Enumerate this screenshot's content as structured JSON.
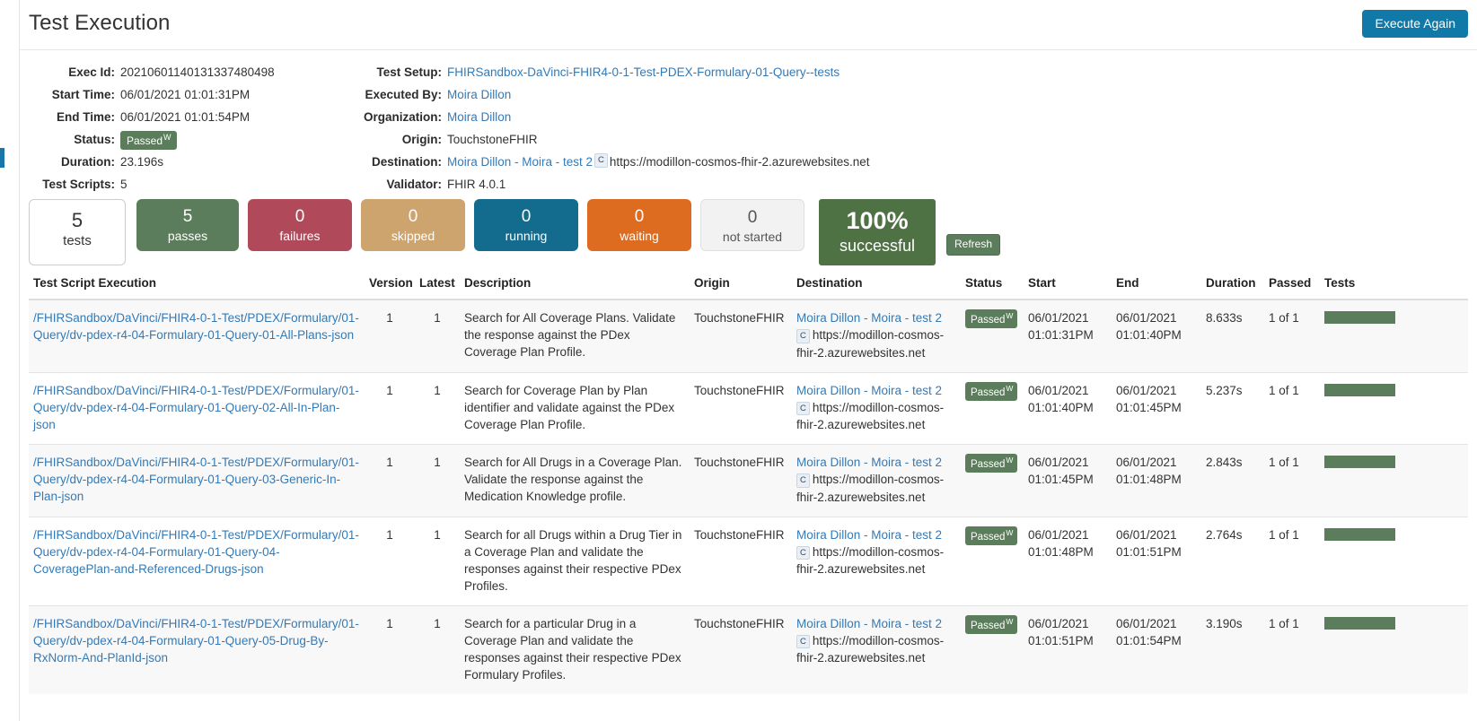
{
  "header": {
    "title": "Test Execution",
    "execute_again_label": "Execute Again"
  },
  "meta": {
    "left": [
      {
        "label": "Exec Id:",
        "value": "20210601140131337480498"
      },
      {
        "label": "Start Time:",
        "value": "06/01/2021 01:01:31PM"
      },
      {
        "label": "End Time:",
        "value": "06/01/2021 01:01:54PM"
      },
      {
        "label": "Status:",
        "value": "Passed",
        "badge_sup": "W"
      },
      {
        "label": "Duration:",
        "value": "23.196s"
      },
      {
        "label": "Test Scripts:",
        "value": "5"
      }
    ],
    "right": [
      {
        "label": "Test Setup:",
        "value": "FHIRSandbox-DaVinci-FHIR4-0-1-Test-PDEX-Formulary-01-Query--tests"
      },
      {
        "label": "Executed By:",
        "value": "Moira Dillon"
      },
      {
        "label": "Organization:",
        "value": "Moira Dillon"
      },
      {
        "label": "Origin:",
        "value": "TouchstoneFHIR"
      },
      {
        "label": "Destination:",
        "value": "Moira Dillon - Moira - test 2",
        "badge": "C",
        "url": "https://modillon-cosmos-fhir-2.azurewebsites.net"
      },
      {
        "label": "Validator:",
        "value": "FHIR 4.0.1"
      }
    ],
    "exec_id_full": "20210601140131337480498"
  },
  "stats": {
    "tests": {
      "num": "5",
      "label": "tests"
    },
    "passes": {
      "num": "5",
      "label": "passes",
      "color": "#5b7d5b"
    },
    "failures": {
      "num": "0",
      "label": "failures",
      "color": "#b04a5a"
    },
    "skipped": {
      "num": "0",
      "label": "skipped",
      "color": "#cda36e"
    },
    "running": {
      "num": "0",
      "label": "running",
      "color": "#136c8e"
    },
    "waiting": {
      "num": "0",
      "label": "waiting",
      "color": "#dd6b20"
    },
    "not_started": {
      "num": "0",
      "label": "not started",
      "color": "#f2f2f2"
    },
    "successful": {
      "num": "100%",
      "label": "successful",
      "color": "#4f7245"
    },
    "refresh_label": "Refresh"
  },
  "table": {
    "columns": [
      "Test Script Execution",
      "Version",
      "Latest",
      "Description",
      "Origin",
      "Destination",
      "Status",
      "Start",
      "End",
      "Duration",
      "Passed",
      "Tests"
    ],
    "rows": [
      {
        "script": "/FHIRSandbox/DaVinci/FHIR4-0-1-Test/PDEX/Formulary/01-Query/dv-pdex-r4-04-Formulary-01-Query-01-All-Plans-json",
        "version": "1",
        "latest": "1",
        "description": "Search for All Coverage Plans. Validate the response against the PDex Coverage Plan Profile.",
        "origin": "TouchstoneFHIR",
        "destination_name": "Moira Dillon - Moira - test 2",
        "destination_badge": "C",
        "destination_url": "https://modillon-cosmos-fhir-2.azurewebsites.net",
        "status": "Passed",
        "status_sup": "W",
        "start_date": "06/01/2021",
        "start_time": "01:01:31PM",
        "end_date": "06/01/2021",
        "end_time": "01:01:40PM",
        "duration": "8.633s",
        "passed": "1 of 1",
        "tests_pct": 100
      },
      {
        "script": "/FHIRSandbox/DaVinci/FHIR4-0-1-Test/PDEX/Formulary/01-Query/dv-pdex-r4-04-Formulary-01-Query-02-All-In-Plan-json",
        "version": "1",
        "latest": "1",
        "description": "Search for Coverage Plan by Plan identifier and validate against the PDex Coverage Plan Profile.",
        "origin": "TouchstoneFHIR",
        "destination_name": "Moira Dillon - Moira - test 2",
        "destination_badge": "C",
        "destination_url": "https://modillon-cosmos-fhir-2.azurewebsites.net",
        "status": "Passed",
        "status_sup": "W",
        "start_date": "06/01/2021",
        "start_time": "01:01:40PM",
        "end_date": "06/01/2021",
        "end_time": "01:01:45PM",
        "duration": "5.237s",
        "passed": "1 of 1",
        "tests_pct": 100
      },
      {
        "script": "/FHIRSandbox/DaVinci/FHIR4-0-1-Test/PDEX/Formulary/01-Query/dv-pdex-r4-04-Formulary-01-Query-03-Generic-In-Plan-json",
        "version": "1",
        "latest": "1",
        "description": "Search for All Drugs in a Coverage Plan. Validate the response against the Medication Knowledge profile.",
        "origin": "TouchstoneFHIR",
        "destination_name": "Moira Dillon - Moira - test 2",
        "destination_badge": "C",
        "destination_url": "https://modillon-cosmos-fhir-2.azurewebsites.net",
        "status": "Passed",
        "status_sup": "W",
        "start_date": "06/01/2021",
        "start_time": "01:01:45PM",
        "end_date": "06/01/2021",
        "end_time": "01:01:48PM",
        "duration": "2.843s",
        "passed": "1 of 1",
        "tests_pct": 100
      },
      {
        "script": "/FHIRSandbox/DaVinci/FHIR4-0-1-Test/PDEX/Formulary/01-Query/dv-pdex-r4-04-Formulary-01-Query-04-CoveragePlan-and-Referenced-Drugs-json",
        "version": "1",
        "latest": "1",
        "description": "Search for all Drugs within a Drug Tier in a Coverage Plan and validate the responses against their respective PDex Profiles.",
        "origin": "TouchstoneFHIR",
        "destination_name": "Moira Dillon - Moira - test 2",
        "destination_badge": "C",
        "destination_url": "https://modillon-cosmos-fhir-2.azurewebsites.net",
        "status": "Passed",
        "status_sup": "W",
        "start_date": "06/01/2021",
        "start_time": "01:01:48PM",
        "end_date": "06/01/2021",
        "end_time": "01:01:51PM",
        "duration": "2.764s",
        "passed": "1 of 1",
        "tests_pct": 100
      },
      {
        "script": "/FHIRSandbox/DaVinci/FHIR4-0-1-Test/PDEX/Formulary/01-Query/dv-pdex-r4-04-Formulary-01-Query-05-Drug-By-RxNorm-And-PlanId-json",
        "version": "1",
        "latest": "1",
        "description": "Search for a particular Drug in a Coverage Plan and validate the responses against their respective PDex Formulary Profiles.",
        "origin": "TouchstoneFHIR",
        "destination_name": "Moira Dillon - Moira - test 2",
        "destination_badge": "C",
        "destination_url": "https://modillon-cosmos-fhir-2.azurewebsites.net",
        "status": "Passed",
        "status_sup": "W",
        "start_date": "06/01/2021",
        "start_time": "01:01:51PM",
        "end_date": "06/01/2021",
        "end_time": "01:01:54PM",
        "duration": "3.190s",
        "passed": "1 of 1",
        "tests_pct": 100
      }
    ]
  },
  "colors": {
    "link": "#337ab7",
    "pass_green": "#5b7d5b",
    "fail_red": "#b04a5a",
    "skip_tan": "#cda36e",
    "running_blue": "#136c8e",
    "waiting_orange": "#dd6b20",
    "primary_button": "#1179a8"
  }
}
